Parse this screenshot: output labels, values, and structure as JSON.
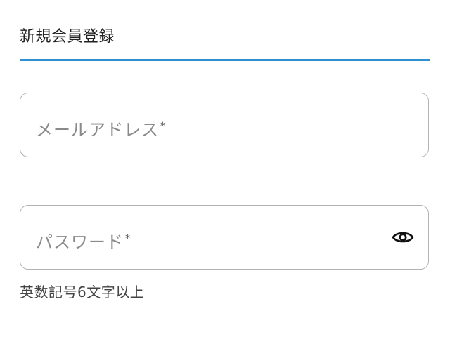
{
  "tab": {
    "title": "新規会員登録"
  },
  "form": {
    "email": {
      "label": "メールアドレス",
      "required_mark": "*"
    },
    "password": {
      "label": "パスワード",
      "required_mark": "*",
      "toggle_icon": "eye-icon",
      "hint": "英数記号6文字以上"
    }
  },
  "colors": {
    "accent": "#2e8fd1",
    "field_border": "#b3b3b3",
    "placeholder": "#8a8a8a"
  }
}
